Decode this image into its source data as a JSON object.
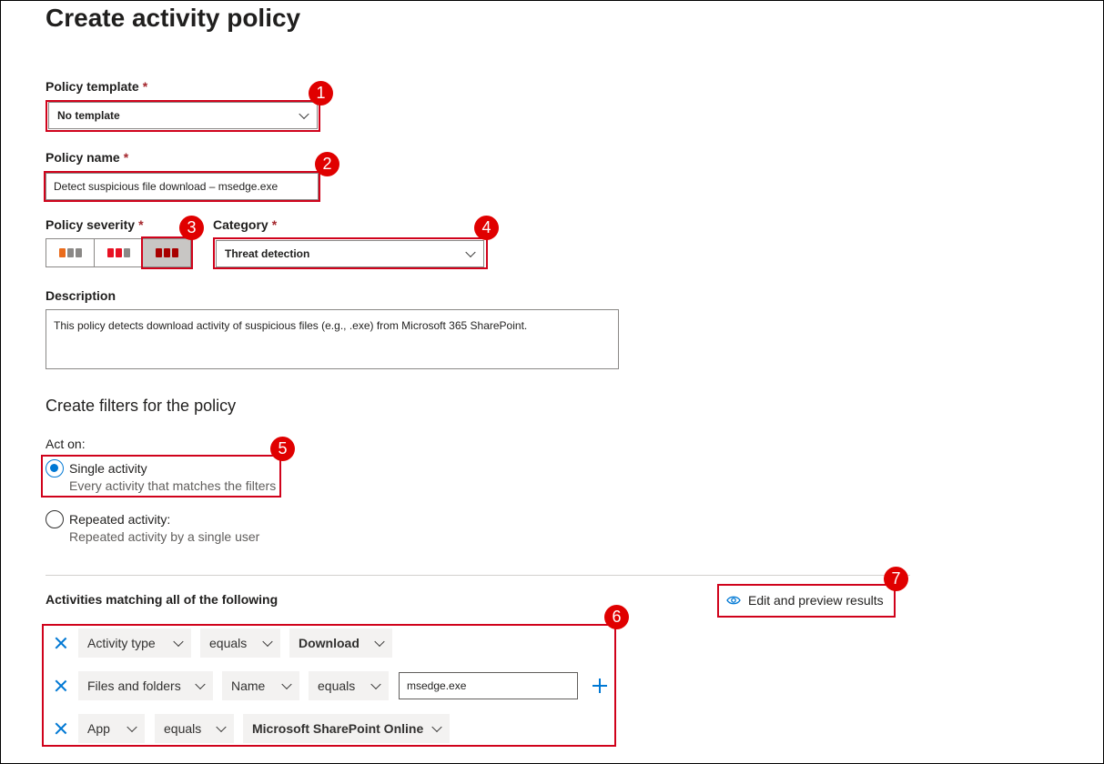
{
  "page": {
    "title": "Create activity policy"
  },
  "form": {
    "policy_template": {
      "label": "Policy template",
      "required_mark": "*",
      "value": "No template"
    },
    "policy_name": {
      "label": "Policy name",
      "required_mark": "*",
      "value": "Detect suspicious file download – msedge.exe"
    },
    "policy_severity": {
      "label": "Policy severity",
      "required_mark": "*",
      "options": [
        "low",
        "medium",
        "high"
      ],
      "selected": "high",
      "colors": {
        "low": "#ea6b1b",
        "medium": "#e81123",
        "high": "#a80000",
        "inactive": "#8a8886"
      }
    },
    "category": {
      "label": "Category",
      "required_mark": "*",
      "value": "Threat detection"
    },
    "description": {
      "label": "Description",
      "value": "This policy detects download activity of suspicious files (e.g., .exe) from Microsoft 365 SharePoint."
    }
  },
  "filters": {
    "heading": "Create filters for the policy",
    "act_on": {
      "label": "Act on:",
      "options": [
        {
          "title": "Single activity",
          "subtitle": "Every activity that matches the filters",
          "checked": true
        },
        {
          "title": "Repeated activity:",
          "subtitle": "Repeated activity by a single user",
          "checked": false
        }
      ]
    },
    "matching": {
      "label": "Activities matching all of the following",
      "preview_button": "Edit and preview results",
      "rows": [
        {
          "chips": [
            "Activity type",
            "equals",
            "Download"
          ]
        },
        {
          "chips": [
            "Files and folders",
            "Name",
            "equals"
          ],
          "input_value": "msedge.exe"
        },
        {
          "chips": [
            "App",
            "equals",
            "Microsoft SharePoint Online"
          ]
        }
      ]
    }
  },
  "callouts": [
    "1",
    "2",
    "3",
    "4",
    "5",
    "6",
    "7"
  ],
  "colors": {
    "accent": "#0078d4",
    "callout": "#e00000",
    "required": "#a4262c"
  }
}
